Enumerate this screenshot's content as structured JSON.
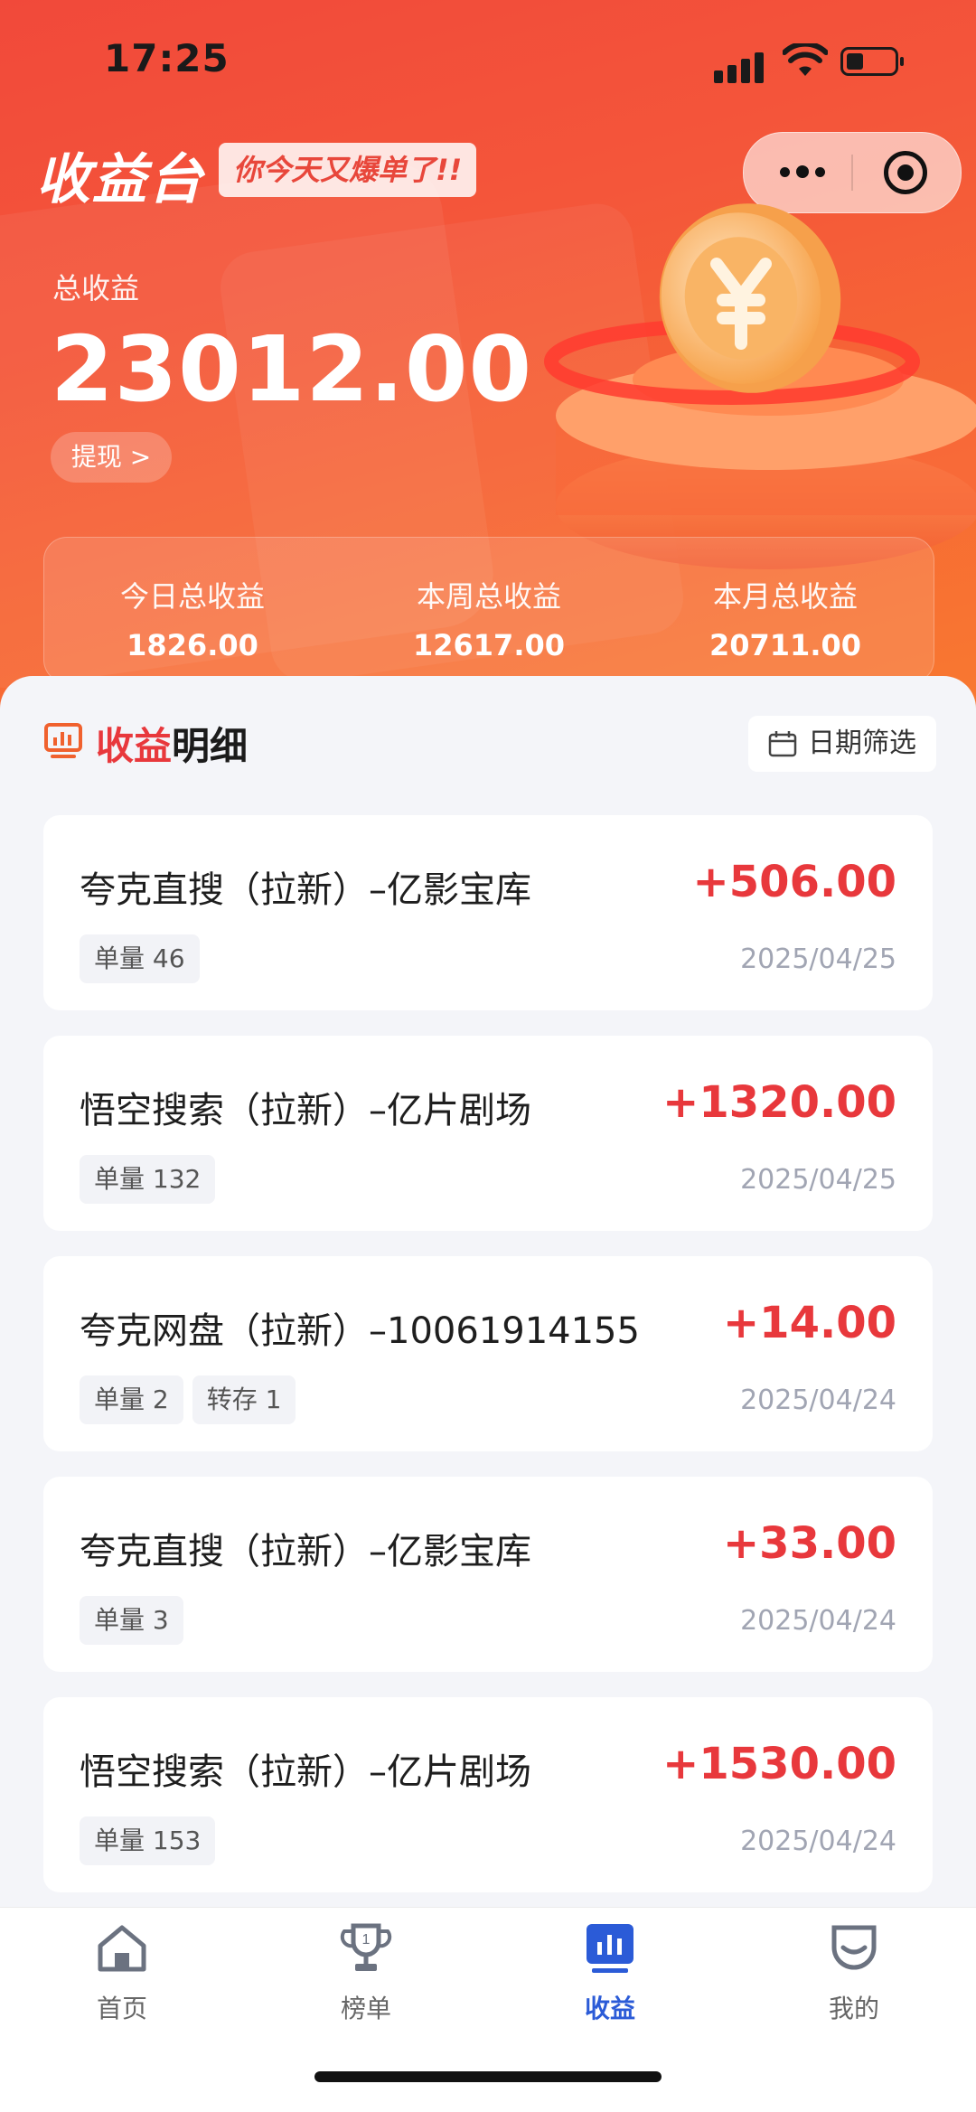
{
  "status_bar": {
    "time": "17:25"
  },
  "header": {
    "brand": "收益台",
    "slogan": "你今天又爆单了!!",
    "total_label": "总收益",
    "total_amount": "23012.00",
    "withdraw_label": "提现 >"
  },
  "summary": [
    {
      "label": "今日总收益",
      "value": "1826.00"
    },
    {
      "label": "本周总收益",
      "value": "12617.00"
    },
    {
      "label": "本月总收益",
      "value": "20711.00"
    }
  ],
  "details": {
    "title_red": "收益",
    "title_rest": "明细",
    "date_filter_label": "日期筛选",
    "items": [
      {
        "title": "夸克直搜（拉新）–亿影宝库",
        "amount": "+506.00",
        "tags": [
          "单量 46"
        ],
        "date": "2025/04/25"
      },
      {
        "title": "悟空搜索（拉新）–亿片剧场",
        "amount": "+1320.00",
        "tags": [
          "单量 132"
        ],
        "date": "2025/04/25"
      },
      {
        "title": "夸克网盘（拉新）–10061914155",
        "amount": "+14.00",
        "tags": [
          "单量 2",
          "转存 1"
        ],
        "date": "2025/04/24"
      },
      {
        "title": "夸克直搜（拉新）–亿影宝库",
        "amount": "+33.00",
        "tags": [
          "单量 3"
        ],
        "date": "2025/04/24"
      },
      {
        "title": "悟空搜索（拉新）–亿片剧场",
        "amount": "+1530.00",
        "tags": [
          "单量 153"
        ],
        "date": "2025/04/24"
      }
    ]
  },
  "tabbar": {
    "tabs": [
      {
        "label": "首页",
        "icon": "home-icon",
        "active": false
      },
      {
        "label": "榜单",
        "icon": "trophy-icon",
        "active": false
      },
      {
        "label": "收益",
        "icon": "earnings-chart-icon",
        "active": true
      },
      {
        "label": "我的",
        "icon": "profile-smile-icon",
        "active": false
      }
    ]
  },
  "colors": {
    "accent_red": "#e8383c",
    "header_gradient_start": "#f1493a",
    "header_gradient_end": "#f87a30",
    "active_tab": "#2b5bd7"
  }
}
